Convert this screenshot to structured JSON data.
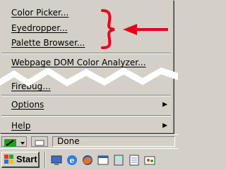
{
  "menu": {
    "items": [
      {
        "label": "Color Picker..."
      },
      {
        "label": "Eyedropper..."
      },
      {
        "label": "Palette Browser..."
      },
      {
        "label": "Webpage DOM Color Analyzer..."
      },
      {
        "label": "Firebug..."
      },
      {
        "label": "Options"
      },
      {
        "label": "Help"
      }
    ]
  },
  "statusbar": {
    "status_text": "Done"
  },
  "taskbar": {
    "start_label": "Start",
    "quick_launch_icons": [
      "desktop-icon",
      "ie-icon",
      "firefox-icon",
      "window-icon",
      "calculator-icon",
      "notepad-icon",
      "paint-icon"
    ]
  },
  "colors": {
    "annotation": "#e8001a",
    "menu_bg": "#d4d0c8"
  }
}
